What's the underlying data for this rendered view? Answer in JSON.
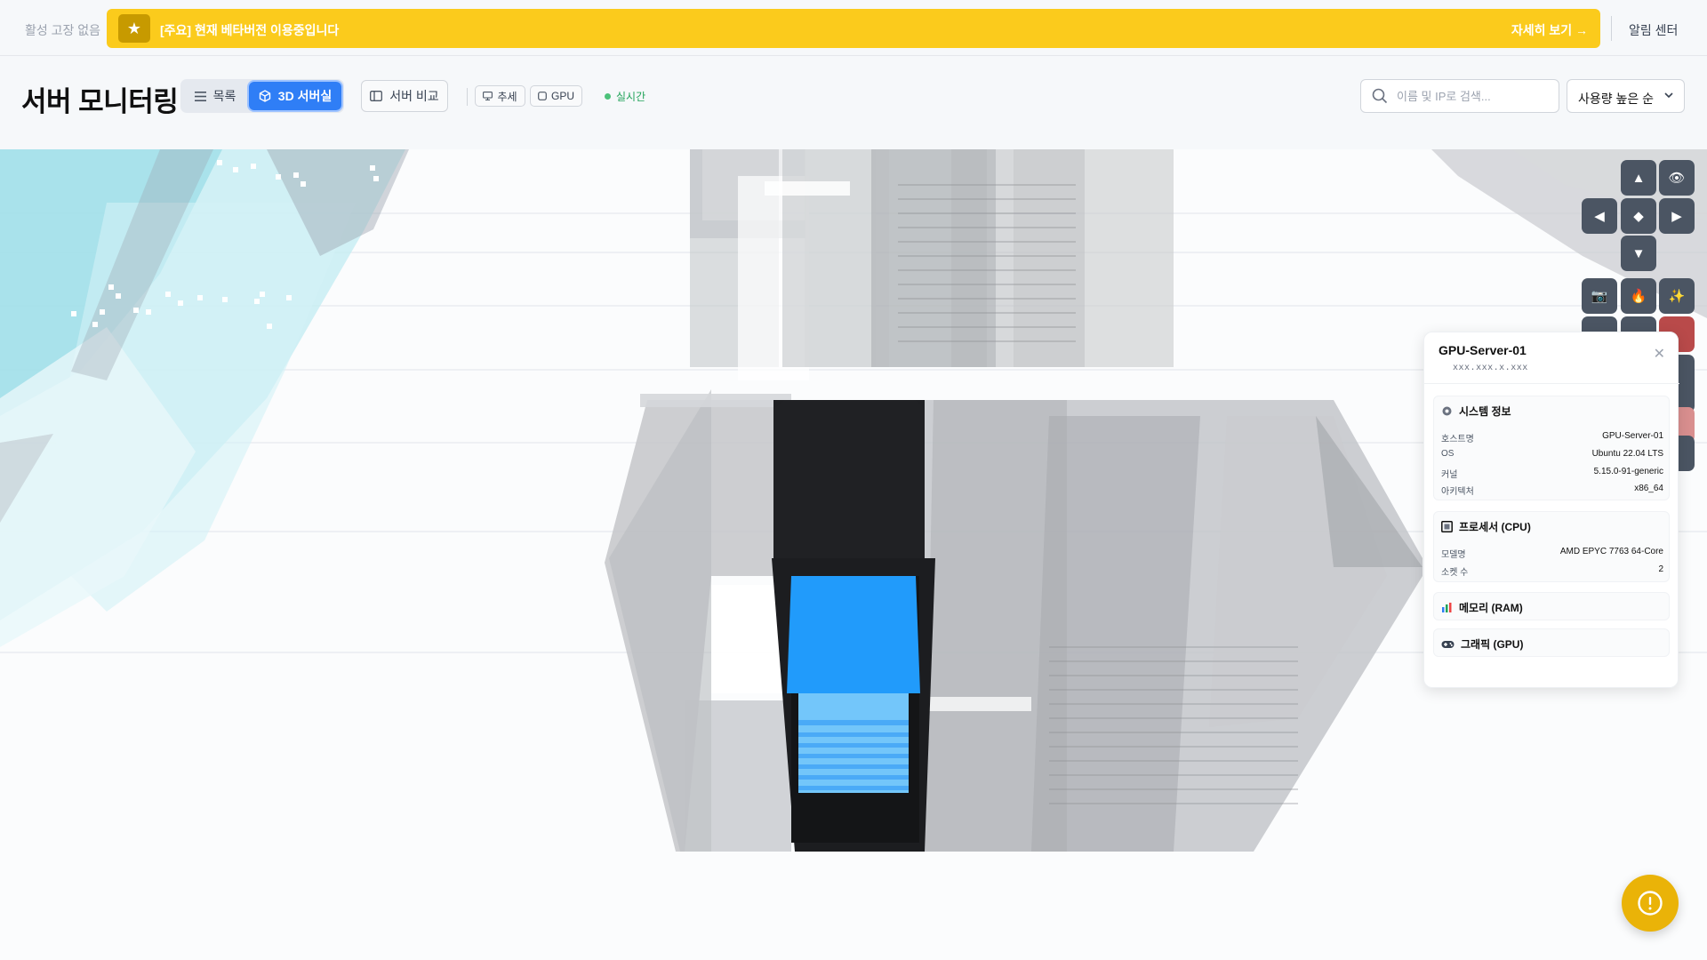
{
  "topbar": {
    "fault_status": "활성 고장 없음",
    "banner_text": "[주요] 현재 베타버전 이용중입니다",
    "banner_link": "자세히 보기 →",
    "alert_center": "알림 센터"
  },
  "header": {
    "title": "서버 모니터링",
    "view_list": "목록",
    "view_3d": "3D 서버실",
    "compare": "서버 비교",
    "chip_trend": "추세",
    "chip_gpu": "GPU",
    "live": "실시간",
    "search_placeholder": "이름 및 IP로 검색...",
    "sort_label": "사용량 높은 순"
  },
  "controls": {
    "up": "▲",
    "left": "◀",
    "center": "◆",
    "right": "▶",
    "down": "▼",
    "eye": "👁",
    "camera": "📷",
    "fire": "🔥",
    "sparkle": "✨"
  },
  "panel": {
    "title": "GPU-Server-01",
    "ip": "xxx.xxx.x.xxx",
    "close": "✕",
    "system": {
      "heading": "시스템 정보",
      "rows": [
        {
          "k": "호스트명",
          "v": "GPU-Server-01"
        },
        {
          "k": "OS",
          "v": "Ubuntu 22.04 LTS"
        },
        {
          "k": "커널",
          "v": "5.15.0-91-generic"
        },
        {
          "k": "아키텍처",
          "v": "x86_64"
        }
      ]
    },
    "cpu": {
      "heading": "프로세서 (CPU)",
      "rows": [
        {
          "k": "모델명",
          "v": "AMD EPYC 7763 64-Core"
        },
        {
          "k": "소켓 수",
          "v": "2"
        }
      ]
    },
    "ram": {
      "heading": "메모리 (RAM)"
    },
    "gpu": {
      "heading": "그래픽 (GPU)"
    }
  },
  "colors": {
    "banner": "#fbcb1c",
    "accent": "#2f7ef6",
    "selected_rack": "#1c1d20",
    "rack_screen": "#219bfb",
    "fab": "#eab308"
  }
}
